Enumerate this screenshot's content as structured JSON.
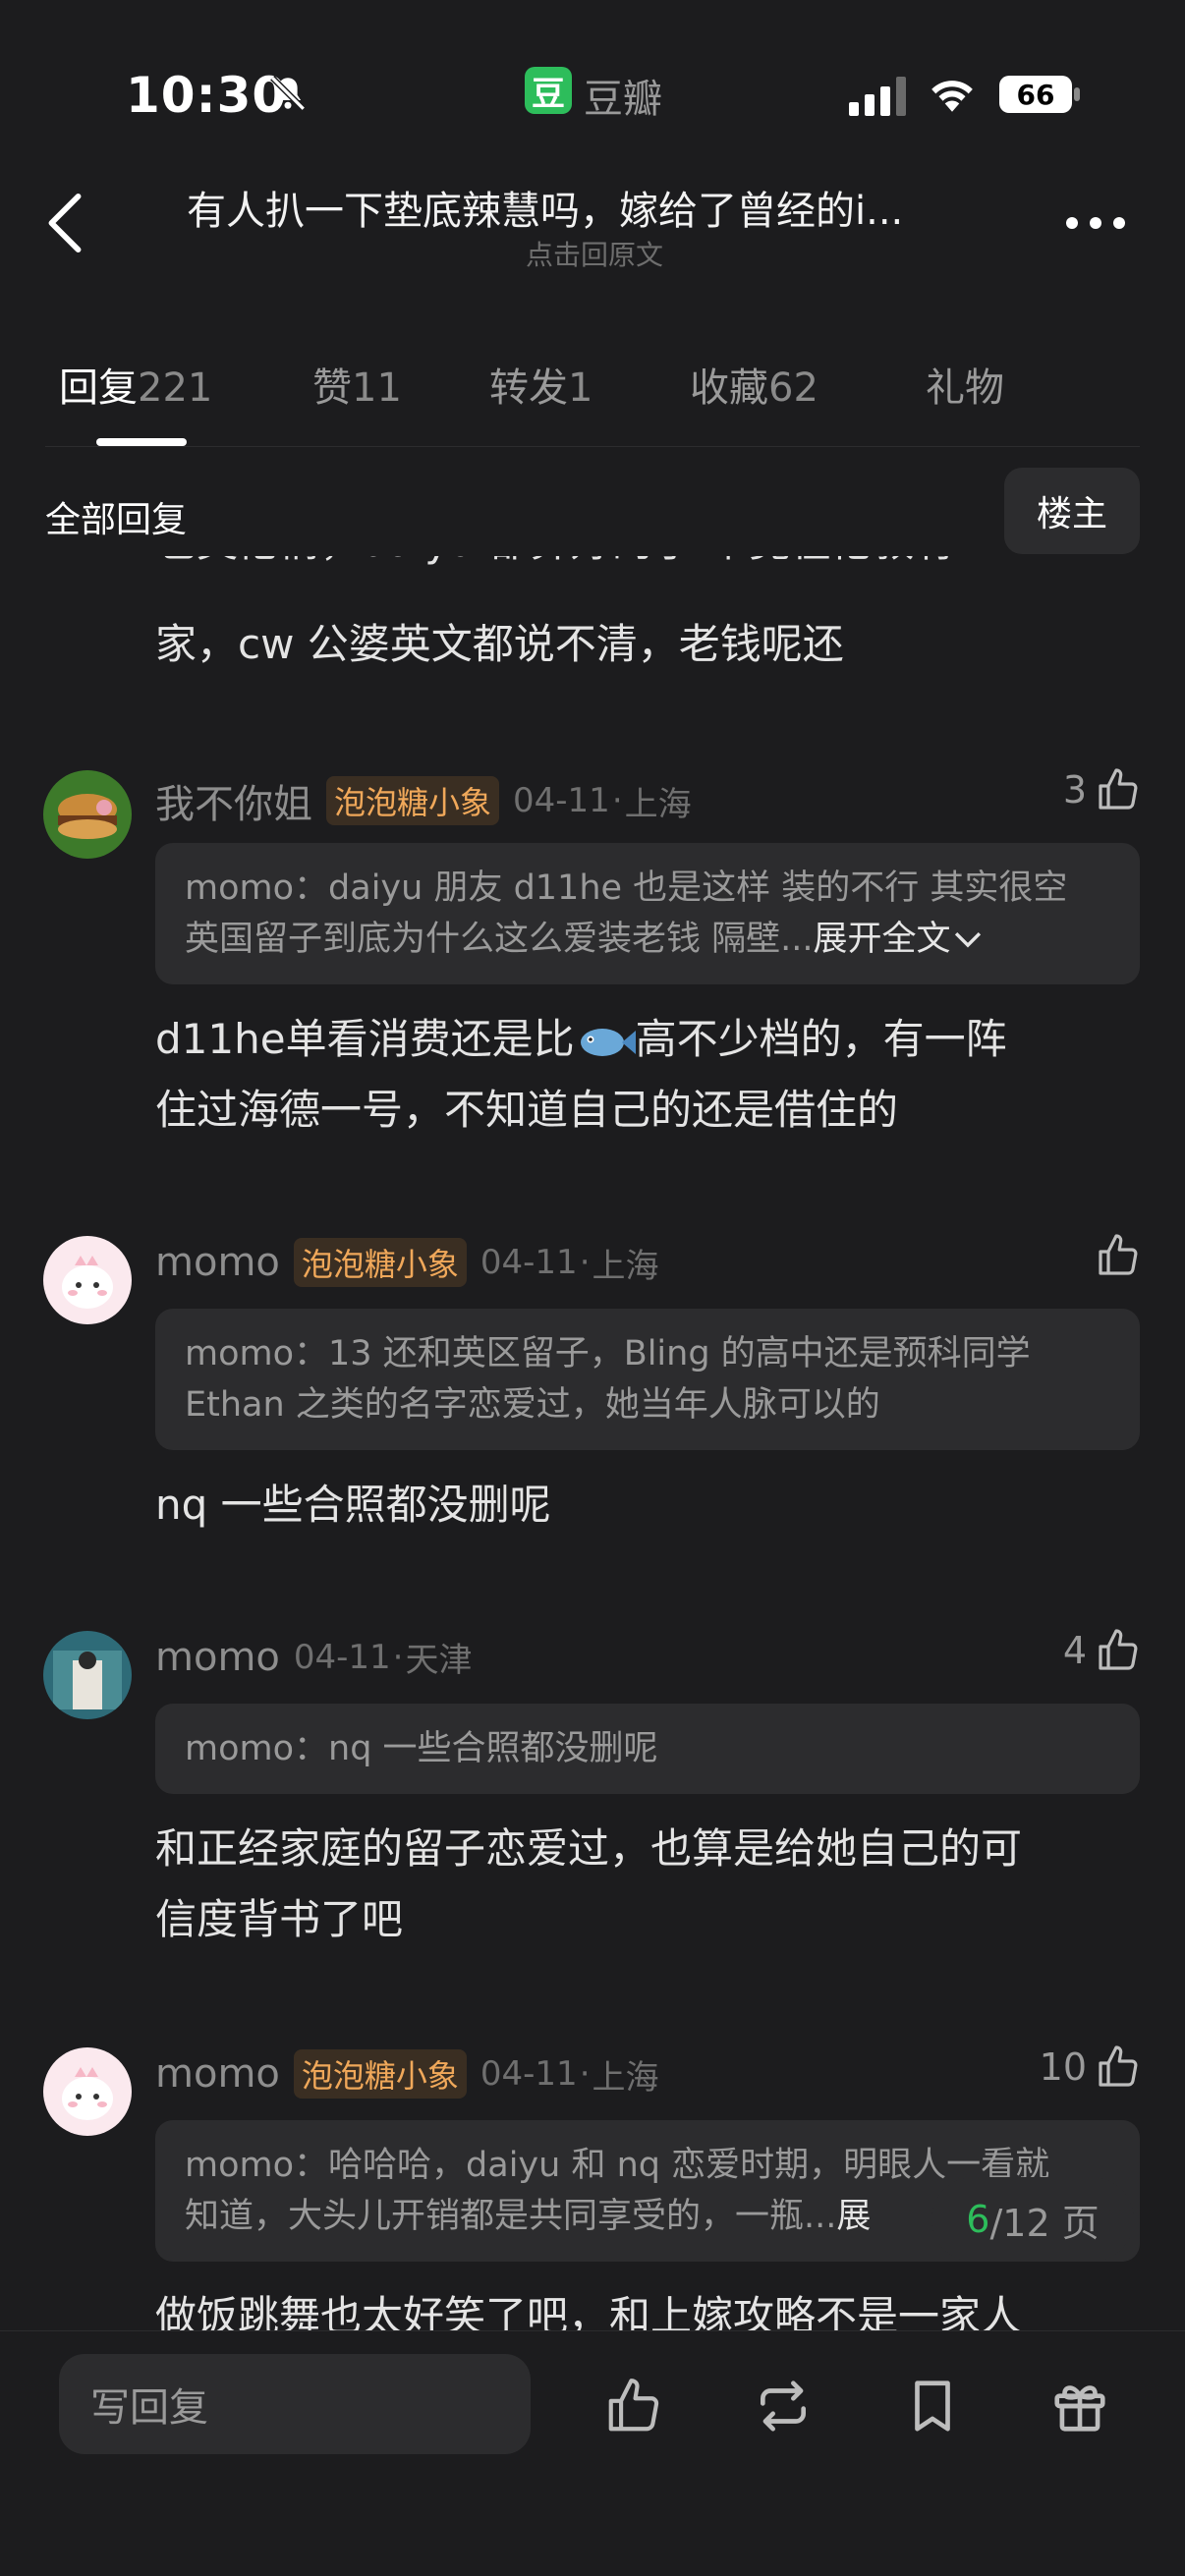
{
  "status_bar": {
    "time": "10:30",
    "app_badge": "豆",
    "app_name": "豆瓣",
    "battery": "66"
  },
  "header": {
    "title": "有人扒一下垫底辣慧吗，嫁给了曾经的i...",
    "subtitle": "点击回原文"
  },
  "tabs": [
    {
      "label": "回复",
      "count": "221"
    },
    {
      "label": "赞",
      "count": "11"
    },
    {
      "label": "转发",
      "count": "1"
    },
    {
      "label": "收藏",
      "count": "62"
    },
    {
      "label": "礼物",
      "count": ""
    }
  ],
  "section": {
    "title": "全部回复",
    "op_filter": "楼主"
  },
  "partial_top": {
    "line1": "也英伦情，daiyu 都算好的了 毕竟在伦敦有",
    "line2": "家，cw 公婆英文都说不清，老钱呢还"
  },
  "comments": [
    {
      "user": "我不你姐",
      "badge": "泡泡糖小象",
      "date": "04-11",
      "location": "上海",
      "likes": "3",
      "quote_author": "momo：",
      "quote_line1": "daiyu 朋友 d11he 也是这样 装的不行 其实很空",
      "quote_line2": "英国留子到底为什么这么爱装老钱 隔壁...",
      "expand": "展开全文",
      "body_line1": "d11he单看消费还是比",
      "body_line1b": "高不少档的，有一阵",
      "body_line2": "住过海德一号，不知道自己的还是借住的"
    },
    {
      "user": "momo",
      "badge": "泡泡糖小象",
      "date": "04-11",
      "location": "上海",
      "likes": "",
      "quote_author": "momo：",
      "quote_line1": "13 还和英区留子，Bling 的高中还是预科同学",
      "quote_line2": "Ethan 之类的名字恋爱过，她当年人脉可以的",
      "body_line1": "nq 一些合照都没删呢"
    },
    {
      "user": "momo",
      "badge": "",
      "date": "04-11",
      "location": "天津",
      "likes": "4",
      "quote_author": "momo：",
      "quote_line1": "nq 一些合照都没删呢",
      "body_line1": "和正经家庭的留子恋爱过，也算是给她自己的可",
      "body_line2": "信度背书了吧"
    },
    {
      "user": "momo",
      "badge": "泡泡糖小象",
      "date": "04-11",
      "location": "上海",
      "likes": "10",
      "quote_author": "momo：",
      "quote_line1": "哈哈哈，daiyu 和 nq 恋爱时期，明眼人一看就",
      "quote_line2": "知道，大头儿开销都是共同享受的，一瓶...",
      "expand": "展",
      "body_line1": "做饭跳舞也太好笑了吧，和上嫁攻略不是一家人"
    }
  ],
  "pager": {
    "current": "6",
    "total": "/12 页"
  },
  "bottom": {
    "reply_placeholder": "写回复"
  },
  "colors": {
    "accent": "#2dbd5b",
    "badge_text": "#f0a85a",
    "background": "#1c1c1e"
  }
}
